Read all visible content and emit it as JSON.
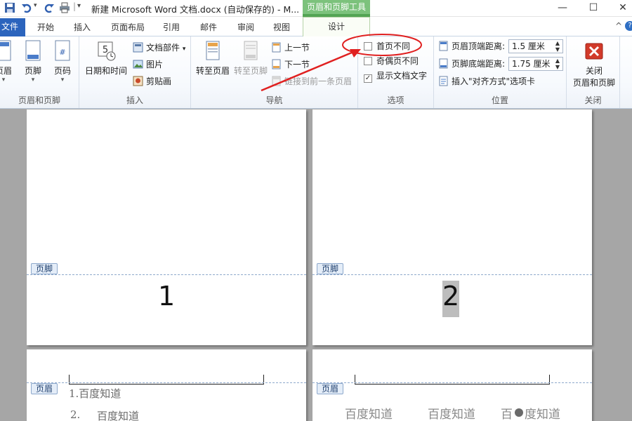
{
  "titlebar": {
    "doc_title": "新建 Microsoft Word 文档.docx (自动保存的)  -  M...",
    "context_tool": "页眉和页脚工具",
    "minimize": "—",
    "maximize": "☐",
    "close": "✕"
  },
  "tabs": {
    "file": "文件",
    "items": [
      "开始",
      "插入",
      "页面布局",
      "引用",
      "邮件",
      "审阅",
      "视图"
    ],
    "design": "设计",
    "collapse": "^",
    "help": "?"
  },
  "ribbon": {
    "group_header_footer": {
      "label": "页眉和页脚",
      "header": "页眉",
      "footer": "页脚",
      "page_number": "页码"
    },
    "group_insert": {
      "label": "插入",
      "date_time": "日期和时间",
      "doc_parts": "文档部件",
      "picture": "图片",
      "clip_art": "剪贴画"
    },
    "group_navigation": {
      "label": "导航",
      "goto_header": "转至页眉",
      "goto_footer": "转至页脚",
      "prev_section": "上一节",
      "next_section": "下一节",
      "link_previous": "链接到前一条页眉"
    },
    "group_options": {
      "label": "选项",
      "different_first_page": "首页不同",
      "different_odd_even": "奇偶页不同",
      "show_document_text": "显示文档文字",
      "different_first_page_checked": false,
      "different_odd_even_checked": false,
      "show_document_text_checked": true
    },
    "group_position": {
      "label": "位置",
      "header_top_label": "页眉顶端距离:",
      "header_top_value": "1.5 厘米",
      "footer_bottom_label": "页脚底端距离:",
      "footer_bottom_value": "1.75 厘米",
      "insert_alignment_tab": "插入\"对齐方式\"选项卡"
    },
    "group_close": {
      "label": "关闭",
      "close_button": "关闭\n页眉和页脚",
      "close_line1": "关闭",
      "close_line2": "页眉和页脚"
    }
  },
  "document": {
    "footer_tag": "页脚",
    "header_tag": "页眉",
    "page1_number": "1",
    "page2_number": "2",
    "page3_list": [
      "1.百度知道",
      "2.",
      "百度知道"
    ],
    "page4_header_text": [
      "百度知道",
      "百度知道",
      "百",
      "度知道"
    ]
  },
  "colors": {
    "file_tab": "#2b64bd",
    "context_tool": "#7cc27c",
    "annotation_red": "#e02020",
    "tag_border": "#8ea9cc"
  }
}
